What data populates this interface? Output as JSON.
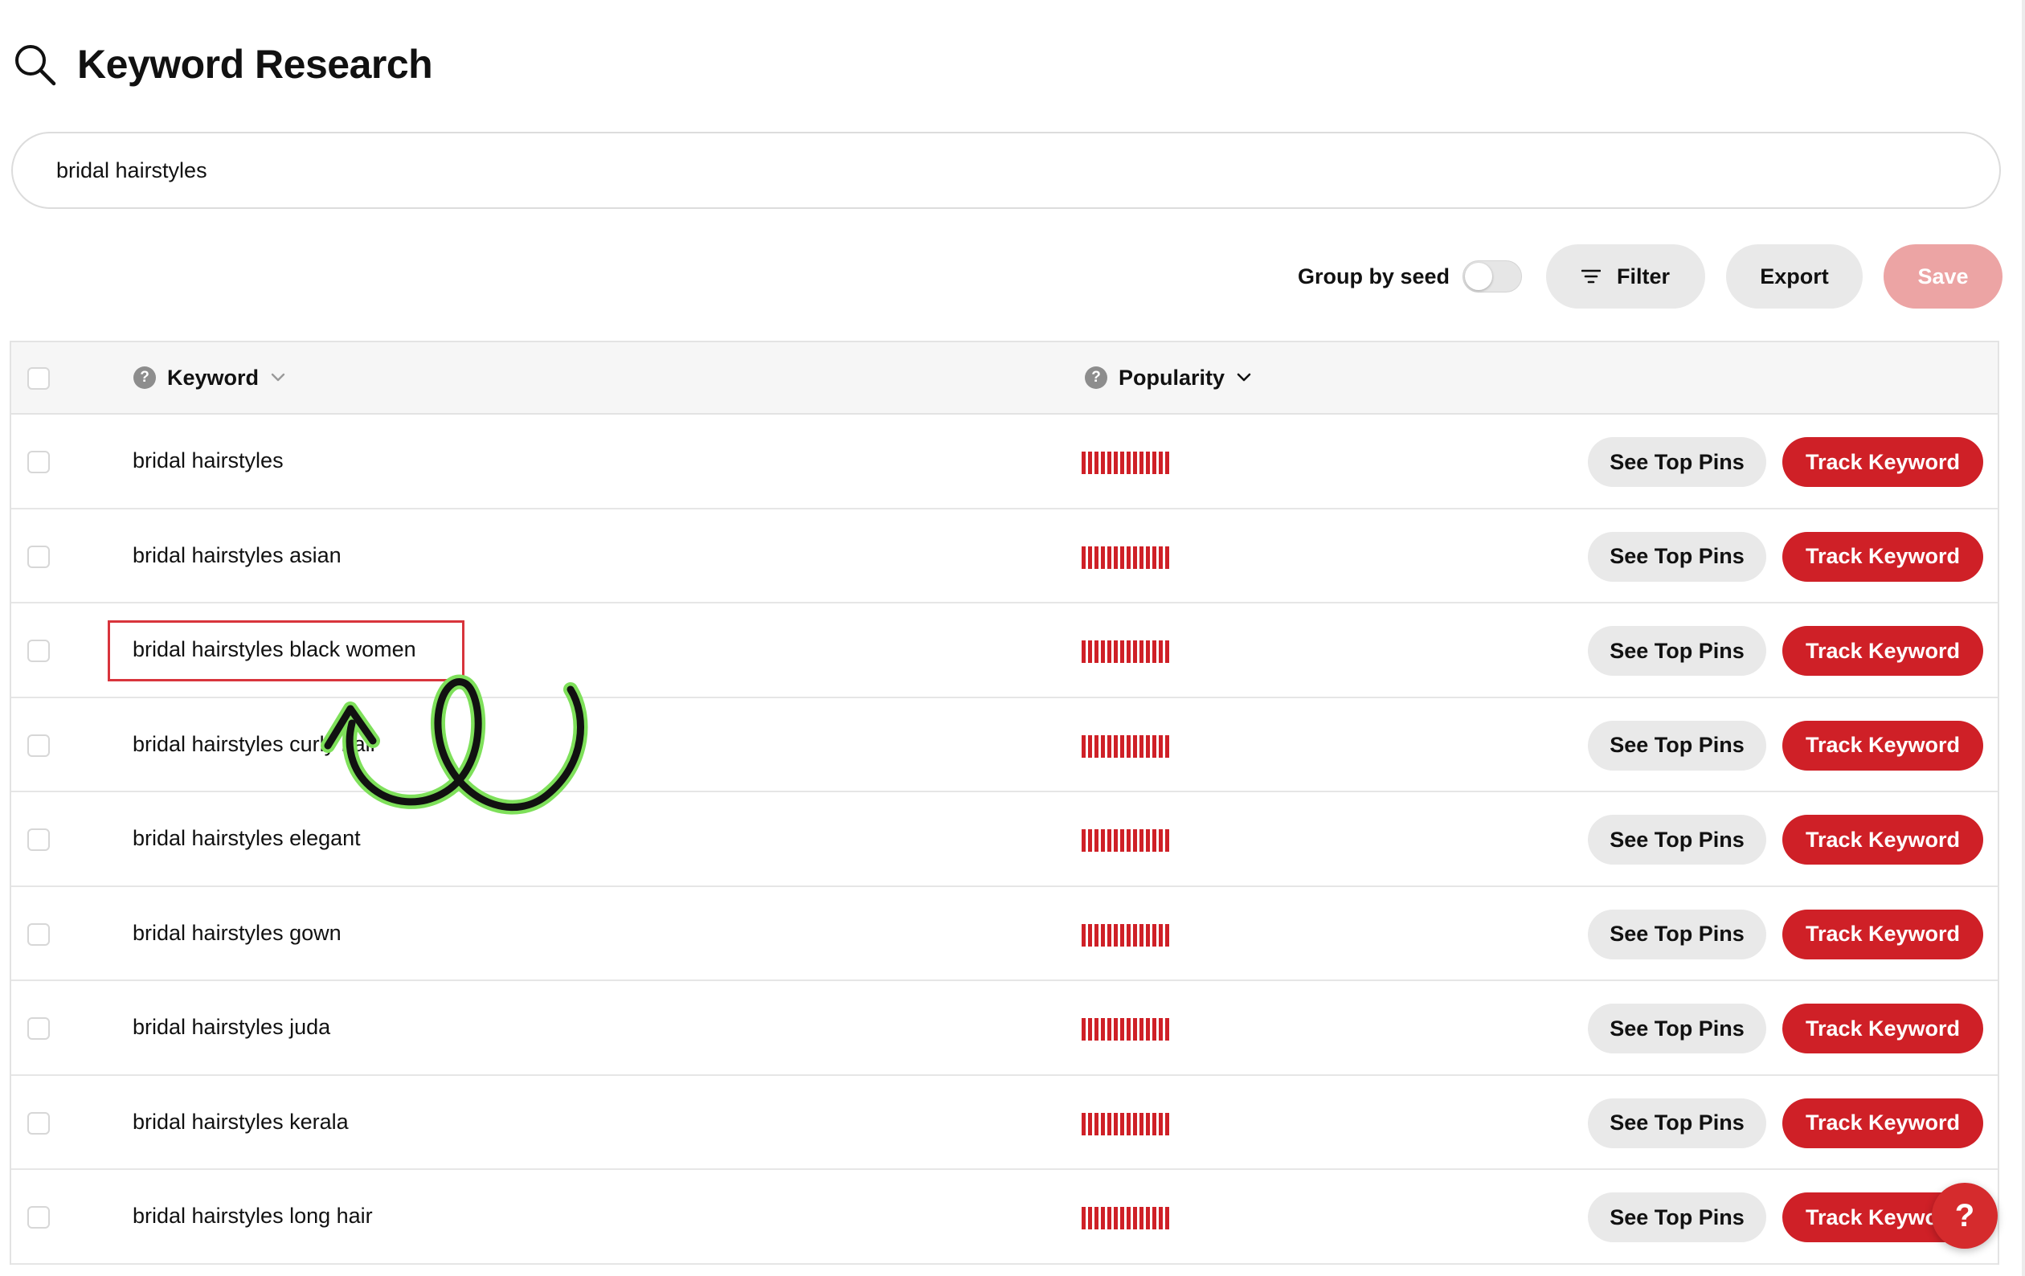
{
  "page": {
    "title": "Keyword Research"
  },
  "search": {
    "value": "bridal hairstyles"
  },
  "toolbar": {
    "group_by_seed_label": "Group by seed",
    "group_by_seed_on": false,
    "filter_label": "Filter",
    "export_label": "Export",
    "save_label": "Save"
  },
  "table": {
    "columns": [
      {
        "label": "Keyword",
        "help": "?"
      },
      {
        "label": "Popularity",
        "help": "?"
      }
    ],
    "see_top_pins_label": "See Top Pins",
    "track_keyword_label": "Track Keyword",
    "rows": [
      {
        "keyword": "bridal hairstyles",
        "popularity_bars": 14,
        "highlighted": false
      },
      {
        "keyword": "bridal hairstyles asian",
        "popularity_bars": 14,
        "highlighted": false
      },
      {
        "keyword": "bridal hairstyles black women",
        "popularity_bars": 14,
        "highlighted": true
      },
      {
        "keyword": "bridal hairstyles curly hair",
        "popularity_bars": 14,
        "highlighted": false
      },
      {
        "keyword": "bridal hairstyles elegant",
        "popularity_bars": 14,
        "highlighted": false
      },
      {
        "keyword": "bridal hairstyles gown",
        "popularity_bars": 14,
        "highlighted": false
      },
      {
        "keyword": "bridal hairstyles juda",
        "popularity_bars": 14,
        "highlighted": false
      },
      {
        "keyword": "bridal hairstyles kerala",
        "popularity_bars": 14,
        "highlighted": false
      },
      {
        "keyword": "bridal hairstyles long hair",
        "popularity_bars": 14,
        "highlighted": false
      }
    ]
  },
  "help_button": {
    "label": "?"
  },
  "colors": {
    "accent_red": "#cf2027",
    "save_disabled": "#eca4a4",
    "button_gray": "#e9e9e9",
    "annotation_arrow": "#111111",
    "annotation_glow": "#7ee05a",
    "highlight_box": "#d8343c"
  },
  "icons": {
    "title_icon": "search-icon",
    "filter_icon": "filter-icon",
    "sort_icon": "chevron-down-icon"
  }
}
